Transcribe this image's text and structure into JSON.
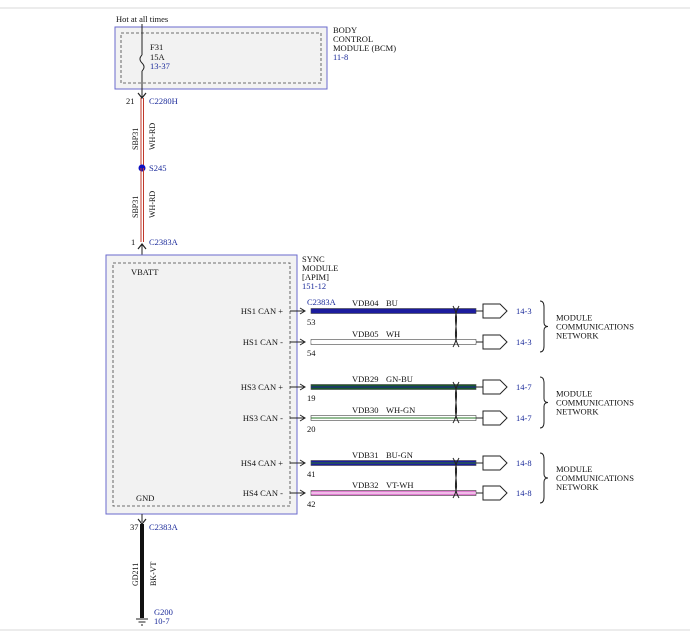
{
  "header": {
    "supply_label": "Hot at all times"
  },
  "bcm": {
    "title_lines": [
      "BODY",
      "CONTROL",
      "MODULE (BCM)"
    ],
    "ref": "11-8",
    "fuse_name": "F31",
    "fuse_rating": "15A",
    "fuse_ref": "13-37"
  },
  "upper_wire": {
    "top_pin": "21",
    "top_connector": "C2280H",
    "circuit_a": "SBP31",
    "color_a": "WH-RD",
    "splice": "S245",
    "circuit_b": "SBP31",
    "color_b": "WH-RD",
    "bottom_pin": "1",
    "bottom_connector": "C2383A"
  },
  "sync": {
    "title_lines": [
      "SYNC",
      "MODULE",
      "[APIM]"
    ],
    "ref": "151-12",
    "vbatt_label": "VBATT",
    "gnd_label": "GND",
    "connector_label": "C2383A"
  },
  "can_lines": [
    {
      "label": "HS1 CAN +",
      "pin": "53",
      "circuit": "VDB04",
      "color_name": "BU",
      "ref": "14-3",
      "stroke": "#1c1c9e",
      "stripe": "#1c1c9e"
    },
    {
      "label": "HS1 CAN -",
      "pin": "54",
      "circuit": "VDB05",
      "color_name": "WH",
      "ref": "14-3",
      "stroke": "#ffffff",
      "stripe": "#ffffff"
    },
    {
      "label": "HS3 CAN +",
      "pin": "19",
      "circuit": "VDB29",
      "color_name": "GN-BU",
      "ref": "14-7",
      "stroke": "#1a5a2a",
      "stripe": "#1c1c9e"
    },
    {
      "label": "HS3 CAN -",
      "pin": "20",
      "circuit": "VDB30",
      "color_name": "WH-GN",
      "ref": "14-7",
      "stroke": "#ffffff",
      "stripe": "#2a7a2a"
    },
    {
      "label": "HS4 CAN +",
      "pin": "41",
      "circuit": "VDB31",
      "color_name": "BU-GN",
      "ref": "14-8",
      "stroke": "#1c1c9e",
      "stripe": "#2a7a2a"
    },
    {
      "label": "HS4 CAN -",
      "pin": "42",
      "circuit": "VDB32",
      "color_name": "VT-WH",
      "ref": "14-8",
      "stroke": "#e07ad0",
      "stripe": "#ffffff"
    }
  ],
  "networks": [
    {
      "lines": [
        "MODULE",
        "COMMUNICATIONS",
        "NETWORK"
      ]
    },
    {
      "lines": [
        "MODULE",
        "COMMUNICATIONS",
        "NETWORK"
      ]
    },
    {
      "lines": [
        "MODULE",
        "COMMUNICATIONS",
        "NETWORK"
      ]
    }
  ],
  "lower_wire": {
    "top_pin": "37",
    "top_connector": "C2383A",
    "circuit": "GD211",
    "color": "BK-VT",
    "ground": "G200",
    "ground_ref": "10-7"
  },
  "colors": {
    "module_border": "#6a6acc",
    "module_fill": "#f2f2f2",
    "ref_text": "#1a2a9a",
    "wire_red": "#c0392b",
    "splice_dot": "#1010c0"
  }
}
